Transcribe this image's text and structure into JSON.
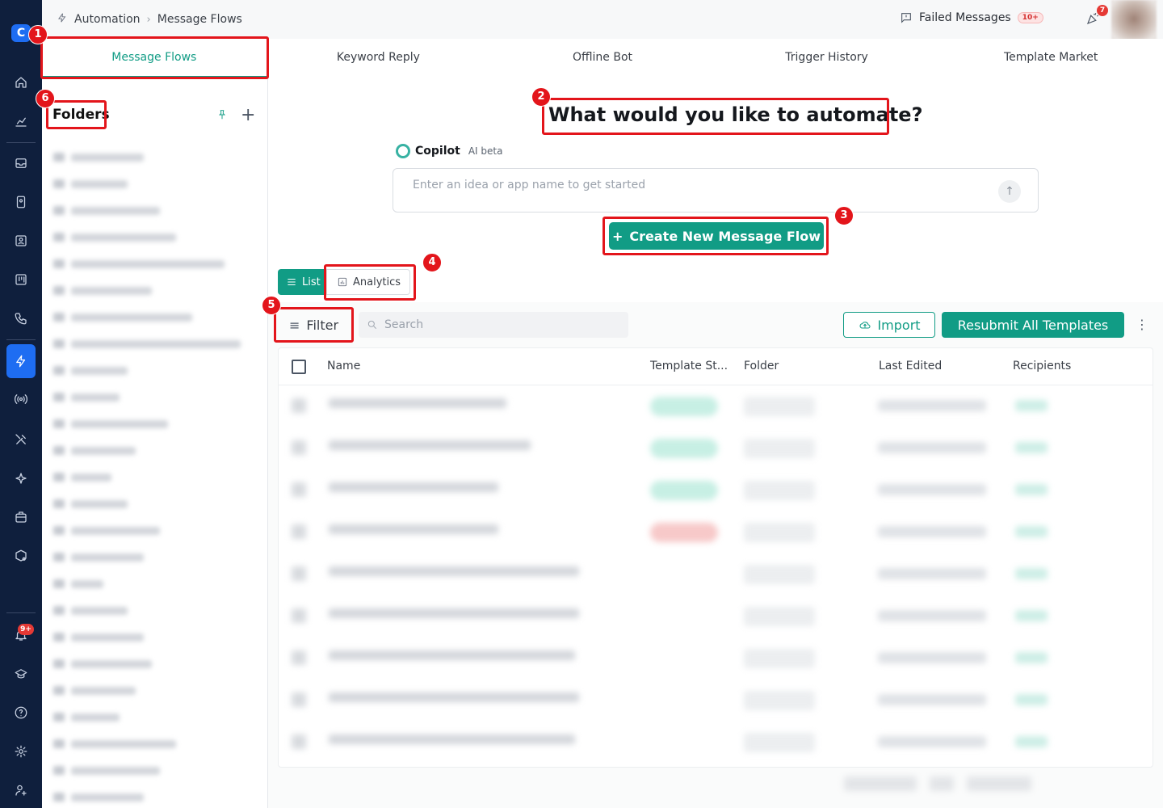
{
  "breadcrumb": [
    "Automation",
    "Message Flows"
  ],
  "topbar": {
    "failed_label": "Failed Messages",
    "failed_badge": "10+",
    "celebrate_badge": "7"
  },
  "rail": {
    "logo_letter": "C",
    "notification_badge": "9+"
  },
  "tabs": [
    "Message Flows",
    "Keyword Reply",
    "Offline Bot",
    "Trigger History",
    "Template Market"
  ],
  "folders": {
    "title": "Folders",
    "add_label": "+",
    "items": [
      "",
      "",
      "",
      "",
      "",
      "",
      "",
      "",
      "",
      "",
      "",
      "",
      "",
      "",
      "",
      "",
      "",
      "",
      "",
      "",
      "",
      "",
      "",
      "",
      ""
    ]
  },
  "main": {
    "headline": "What would you like to automate?",
    "copilot_label": "Copilot",
    "copilot_beta": "AI beta",
    "idea_placeholder": "Enter an idea or app name to get started",
    "create_label": "Create New Message Flow",
    "view_list": "List",
    "view_analytics": "Analytics",
    "filter_label": "Filter",
    "search_placeholder": "Search",
    "import_label": "Import",
    "resubmit_label": "Resubmit All Templates"
  },
  "table": {
    "columns": [
      "Name",
      "Template St...",
      "Folder",
      "Last Edited",
      "Recipients"
    ],
    "rows": [
      {
        "status": "ok"
      },
      {
        "status": "ok"
      },
      {
        "status": "ok"
      },
      {
        "status": "bad"
      },
      {
        "status": ""
      },
      {
        "status": ""
      },
      {
        "status": ""
      },
      {
        "status": ""
      },
      {
        "status": ""
      }
    ]
  },
  "annotations": [
    "1",
    "2",
    "3",
    "4",
    "5",
    "6"
  ],
  "colors": {
    "accent": "#119c85",
    "rail": "#0f1f3d",
    "rail_active": "#1e6df2",
    "annotation": "#e3151b"
  }
}
